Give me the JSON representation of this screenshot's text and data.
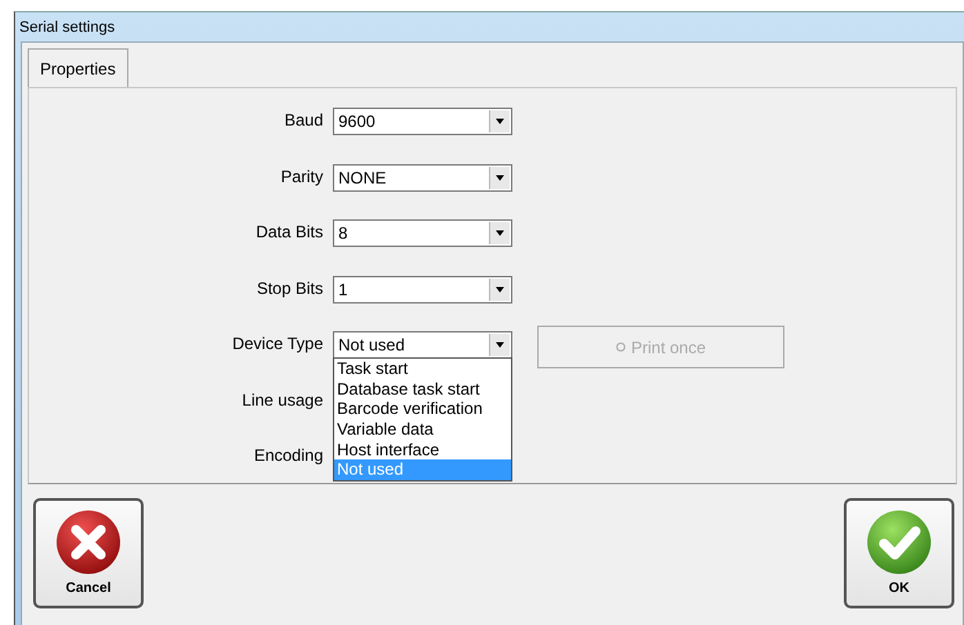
{
  "window": {
    "title": "Serial settings"
  },
  "tabs": [
    {
      "label": "Properties",
      "selected": true
    }
  ],
  "fields": [
    {
      "label": "Baud",
      "value": "9600"
    },
    {
      "label": "Parity",
      "value": "NONE"
    },
    {
      "label": "Data Bits",
      "value": "8"
    },
    {
      "label": "Stop Bits",
      "value": "1"
    },
    {
      "label": "Device Type",
      "value": "Not used",
      "expanded": true
    },
    {
      "label": "Line usage"
    },
    {
      "label": "Encoding"
    }
  ],
  "dropdown_options": [
    {
      "label": "Task start",
      "selected": false
    },
    {
      "label": "Database task start",
      "selected": false
    },
    {
      "label": "Barcode verification",
      "selected": false
    },
    {
      "label": "Variable data",
      "selected": false
    },
    {
      "label": "Host interface",
      "selected": false
    },
    {
      "label": "Not used",
      "selected": true
    }
  ],
  "print_once_button": {
    "label": "Print once",
    "disabled": true
  },
  "buttons": [
    {
      "kind": "cancel",
      "label": "Cancel"
    },
    {
      "kind": "ok",
      "label": "OK"
    }
  ]
}
